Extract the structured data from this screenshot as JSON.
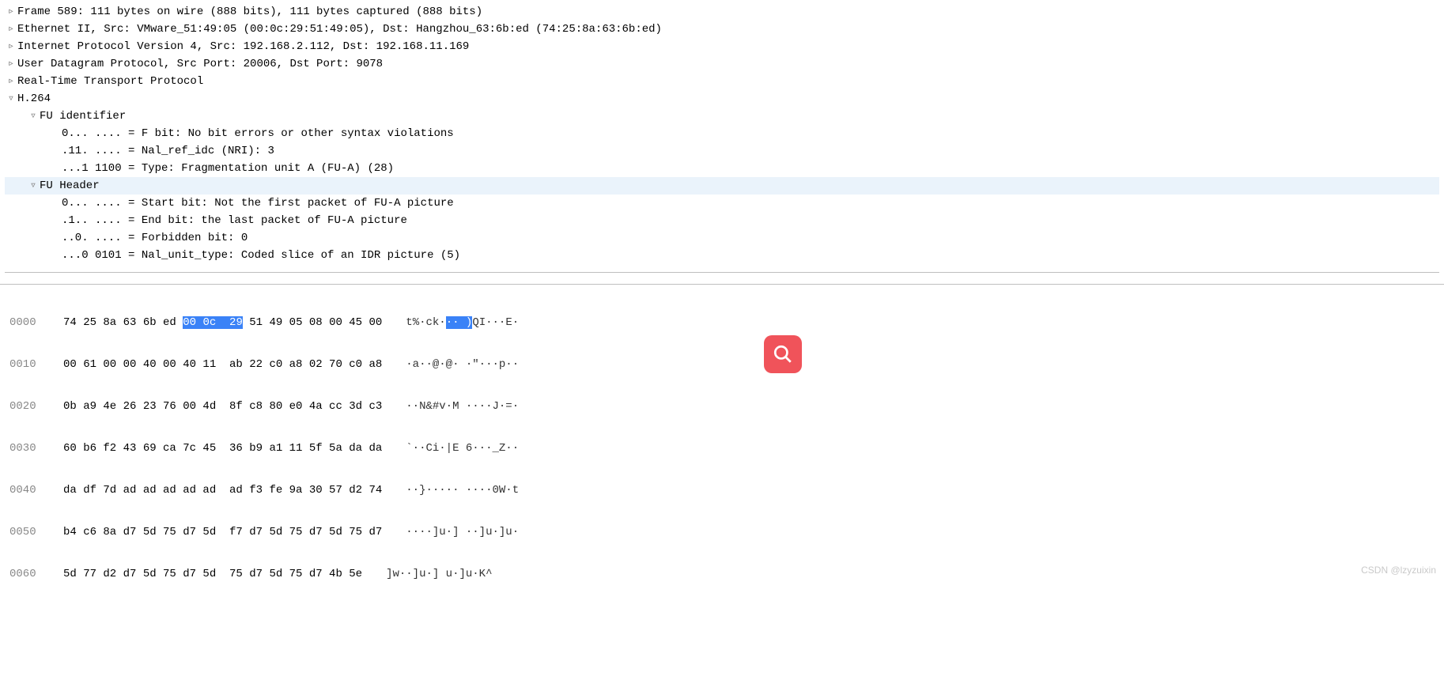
{
  "tree": {
    "frame": "Frame 589: 111 bytes on wire (888 bits), 111 bytes captured (888 bits)",
    "eth": "Ethernet II, Src: VMware_51:49:05 (00:0c:29:51:49:05), Dst: Hangzhou_63:6b:ed (74:25:8a:63:6b:ed)",
    "ip": "Internet Protocol Version 4, Src: 192.168.2.112, Dst: 192.168.11.169",
    "udp": "User Datagram Protocol, Src Port: 20006, Dst Port: 9078",
    "rtp": "Real-Time Transport Protocol",
    "h264": "H.264",
    "fu_id": "FU identifier",
    "fbit": "0... .... = F bit: No bit errors or other syntax violations",
    "nri": ".11. .... = Nal_ref_idc (NRI): 3",
    "type": "...1 1100 = Type: Fragmentation unit A (FU-A) (28)",
    "fu_hdr": "FU Header",
    "start": "0... .... = Start bit: Not the first packet of FU-A picture",
    "end": ".1.. .... = End bit: the last packet of FU-A picture",
    "forbid": "..0. .... = Forbidden bit: 0",
    "nalut": "...0 0101 = Nal_unit_type: Coded slice of an IDR picture (5)"
  },
  "hex": {
    "l0": {
      "off": "0000",
      "a": "74 25 8a 63 6b ed ",
      "h": "00 0c  29",
      "b": " 51 49 05 08 00 45 00",
      "ascii_a": "t%·ck·",
      "ascii_h": "·· )",
      "ascii_b": "QI···E·"
    },
    "l1": {
      "off": "0010",
      "bytes": "00 61 00 00 40 00 40 11  ab 22 c0 a8 02 70 c0 a8",
      "ascii": "·a··@·@· ·\"···p··"
    },
    "l2": {
      "off": "0020",
      "bytes": "0b a9 4e 26 23 76 00 4d  8f c8 80 e0 4a cc 3d c3",
      "ascii": "··N&#v·M ····J·=·"
    },
    "l3": {
      "off": "0030",
      "bytes": "60 b6 f2 43 69 ca 7c 45  36 b9 a1 11 5f 5a da da",
      "ascii": "`··Ci·|E 6···_Z··"
    },
    "l4": {
      "off": "0040",
      "bytes": "da df 7d ad ad ad ad ad  ad f3 fe 9a 30 57 d2 74",
      "ascii": "··}····· ····0W·t"
    },
    "l5": {
      "off": "0050",
      "bytes": "b4 c6 8a d7 5d 75 d7 5d  f7 d7 5d 75 d7 5d 75 d7",
      "ascii": "····]u·] ··]u·]u·"
    },
    "l6": {
      "off": "0060",
      "bytes": "5d 77 d2 d7 5d 75 d7 5d  75 d7 5d 75 d7 4b 5e",
      "ascii": "]w··]u·] u·]u·K^"
    }
  },
  "watermark": "CSDN @lzyzuixin"
}
